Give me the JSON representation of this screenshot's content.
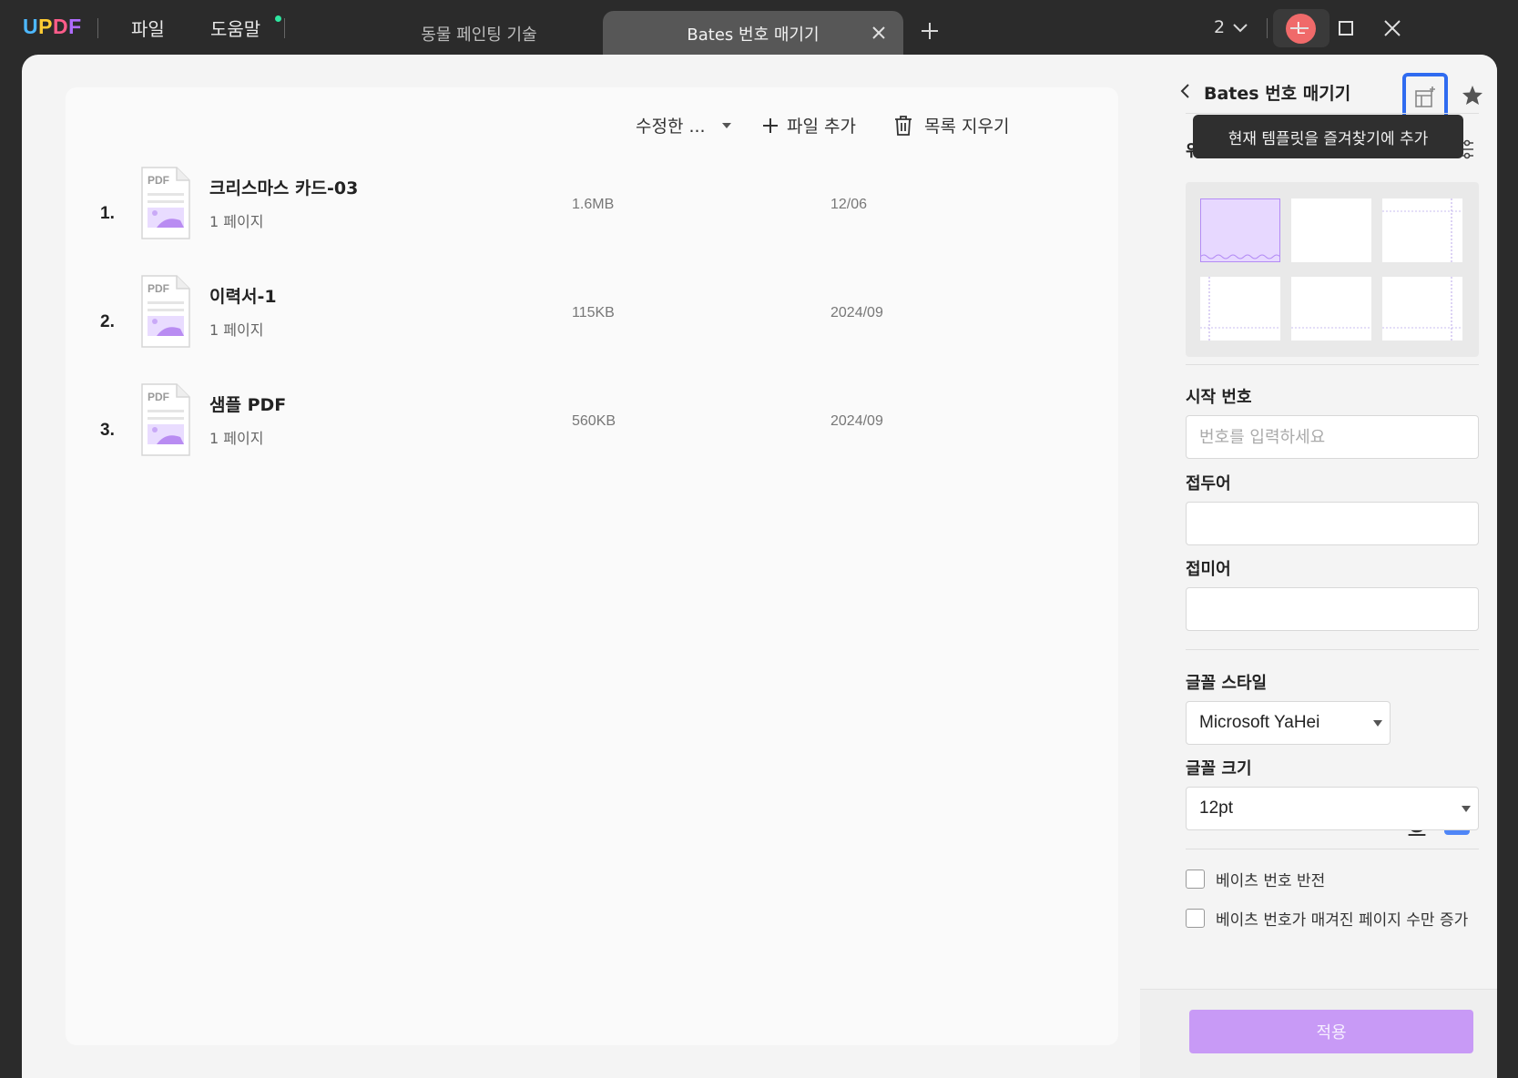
{
  "app": {
    "logo": {
      "u": "U",
      "p": "P",
      "d": "D",
      "f": "F"
    },
    "menu": {
      "file": "파일",
      "help": "도움말"
    },
    "tabs": [
      {
        "label": "동물 페인팅 기술"
      },
      {
        "label": "Bates 번호 매기기"
      }
    ],
    "window_count": "2",
    "avatar_initial": "L"
  },
  "toolbar": {
    "sort_label": "수정한 ...",
    "add_file_label": "파일 추가",
    "clear_list_label": "목록 지우기"
  },
  "files": [
    {
      "index": "1.",
      "name": "크리스마스 카드-03",
      "pages": "1 페이지",
      "size": "1.6MB",
      "date": "12/06"
    },
    {
      "index": "2.",
      "name": "이력서-1",
      "pages": "1 페이지",
      "size": "115KB",
      "date": "2024/09"
    },
    {
      "index": "3.",
      "name": "샘플 PDF",
      "pages": "1 페이지",
      "size": "560KB",
      "date": "2024/09"
    }
  ],
  "pdf_icon_label": "PDF",
  "panel": {
    "title": "Bates 번호 매기기",
    "tooltip": "현재 템플릿을 즐겨찾기에 추가",
    "position_label": "위치",
    "start_number_label": "시작 번호",
    "start_number_placeholder": "번호를 입력하세요",
    "prefix_label": "접두어",
    "prefix_value": "",
    "suffix_label": "접미어",
    "suffix_value": "",
    "font_style_label": "글꼴 스타일",
    "font_family_value": "Microsoft YaHei",
    "font_size_label": "글꼴 크기",
    "font_size_value": "12pt",
    "checkbox_reverse": "베이츠 번호 반전",
    "checkbox_only_numbered": "베이츠 번호가 매겨진 페이지 수만 증가",
    "apply_label": "적용"
  },
  "colors": {
    "accent": "#2f6bf0",
    "font_color": "#4f86f7",
    "apply_button": "#c89af6",
    "avatar": "#f06a6a",
    "selected_position": "#e7d8ff"
  }
}
